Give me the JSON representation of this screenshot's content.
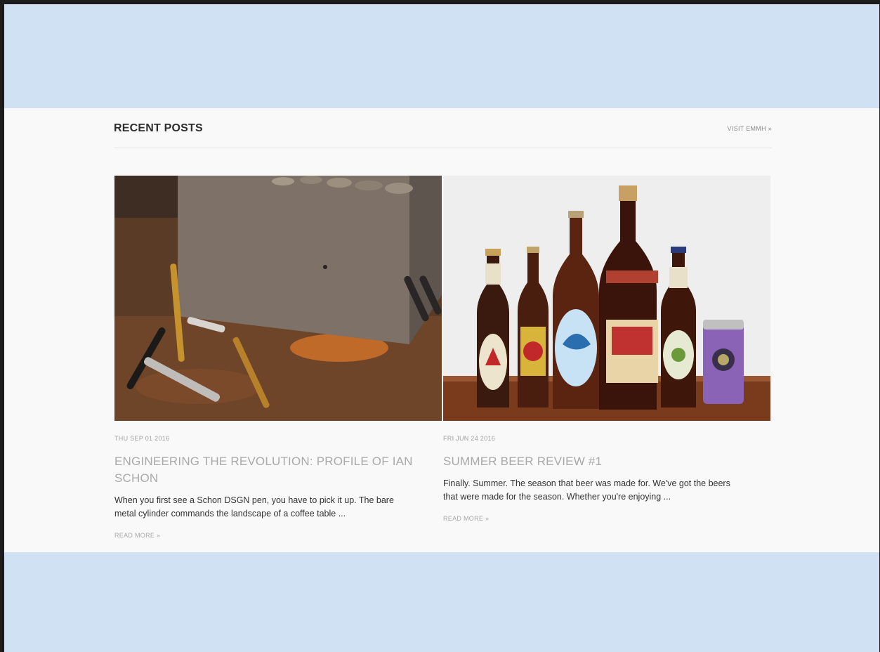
{
  "section": {
    "title": "RECENT POSTS",
    "visit_link": "VISIT EMMH »"
  },
  "posts": [
    {
      "date": "THU SEP 01 2016",
      "title": "ENGINEERING THE REVOLUTION: PROFILE OF IAN SCHON",
      "excerpt": "When you first see a Schon DSGN pen, you have to pick it up. The bare metal cylinder commands the landscape of a coffee table ...",
      "read_more": "READ MORE »"
    },
    {
      "date": "FRI JUN 24 2016",
      "title": "SUMMER BEER REVIEW #1",
      "excerpt": "Finally. Summer. The season that beer was made for. We've got the beers that were made for the season. Whether you're enjoying ...",
      "read_more": "READ MORE »"
    }
  ],
  "colors": {
    "outer_background": "#cfe1f2",
    "panel_background": "#f9f9f9",
    "title_gray": "#a9a9a9"
  }
}
